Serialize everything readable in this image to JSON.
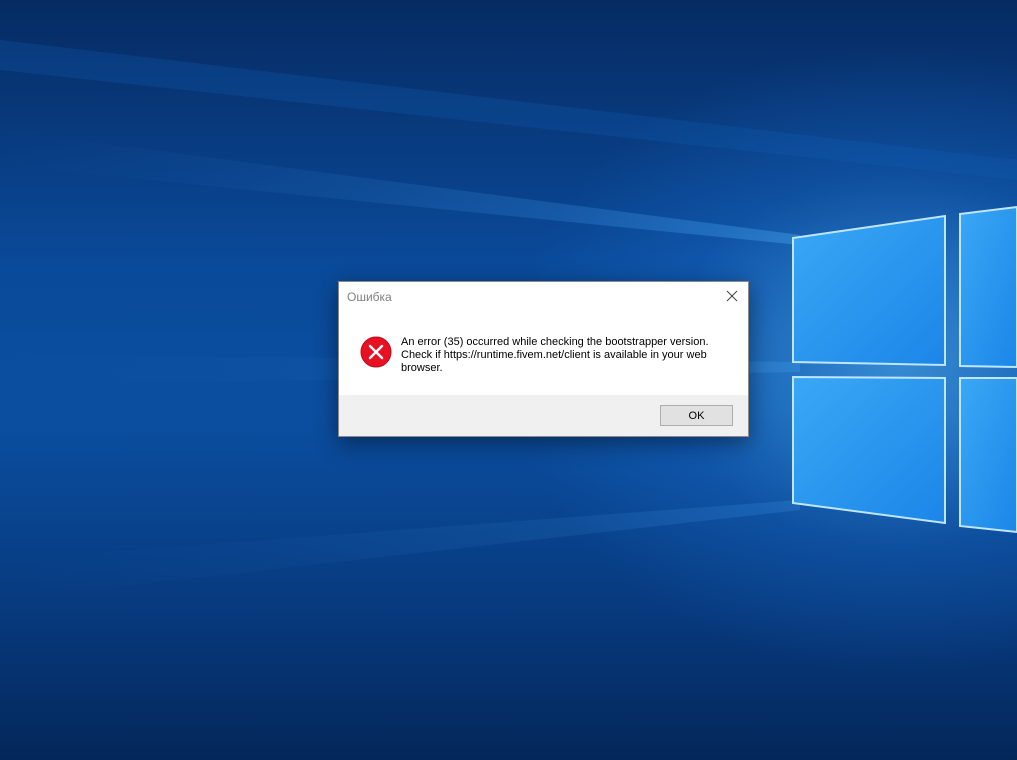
{
  "dialog": {
    "title": "Ошибка",
    "message": "An error (35) occurred while checking the bootstrapper version. Check if https://runtime.fivem.net/client is available in your web browser.",
    "ok_label": "OK",
    "icon": "error-icon"
  },
  "colors": {
    "error_red": "#e81123",
    "footer_gray": "#f0f0f0",
    "title_gray": "#808080"
  }
}
